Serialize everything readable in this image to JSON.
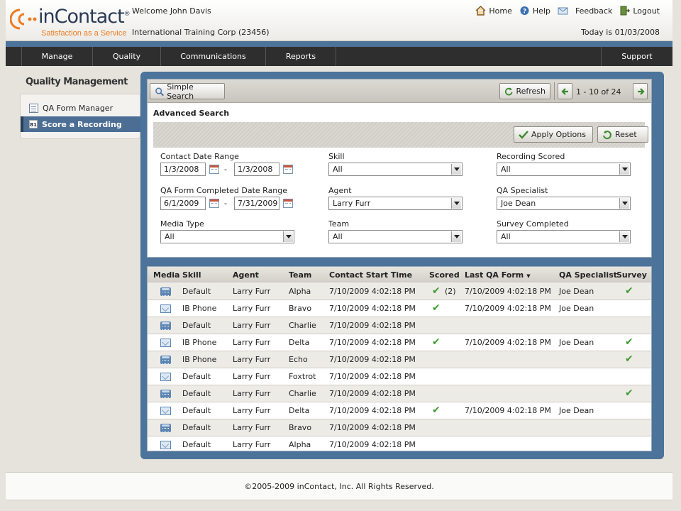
{
  "header": {
    "brand_prefix": "in",
    "brand_name": "Contact",
    "tagline": "Satisfaction as a Service",
    "welcome": "Welcome John Davis",
    "company": "International Training Corp (23456)",
    "today": "Today is 01/03/2008",
    "links": {
      "home": "Home",
      "help": "Help",
      "feedback": "Feedback",
      "logout": "Logout"
    }
  },
  "nav": {
    "manage": "Manage",
    "quality": "Quality",
    "communications": "Communications",
    "reports": "Reports",
    "support": "Support"
  },
  "sidebar": {
    "title": "Quality Management",
    "items": [
      {
        "label": "QA Form Manager",
        "icon": "form-icon"
      },
      {
        "label": "Score a Recording",
        "icon": "score-icon",
        "badge": "81",
        "selected": true
      }
    ]
  },
  "toolbar": {
    "simple_search": "Simple Search",
    "refresh": "Refresh",
    "pager": "1 - 10 of 24"
  },
  "advanced": {
    "title": "Advanced Search",
    "apply": "Apply Options",
    "reset": "Reset",
    "contact_date_label": "Contact Date Range",
    "contact_date_from": "1/3/2008",
    "contact_date_to": "1/3/2008",
    "qa_completed_label": "QA Form Completed Date Range",
    "qa_completed_from": "6/1/2009",
    "qa_completed_to": "7/31/2009",
    "media_type_label": "Media Type",
    "media_type_value": "All",
    "skill_label": "Skill",
    "skill_value": "All",
    "agent_label": "Agent",
    "agent_value": "Larry Furr",
    "team_label": "Team",
    "team_value": "All",
    "recording_scored_label": "Recording Scored",
    "recording_scored_value": "All",
    "qa_specialist_label": "QA Specialist",
    "qa_specialist_value": "Joe Dean",
    "survey_completed_label": "Survey Completed",
    "survey_completed_value": "All",
    "range_separator": "-"
  },
  "table": {
    "headers": {
      "media": "Media",
      "skill": "Skill",
      "agent": "Agent",
      "team": "Team",
      "start": "Contact Start Time",
      "scored": "Scored",
      "last_qa": "Last QA Form",
      "specialist": "QA Specialist",
      "survey": "Survey"
    },
    "rows": [
      {
        "media": "phone",
        "skill": "Default",
        "agent": "Larry Furr",
        "team": "Alpha",
        "start": "7/10/2009 4:02:18 PM",
        "scored": true,
        "score_count": "(2)",
        "last_qa": "7/10/2009 4:02:18 PM",
        "specialist": "Joe Dean",
        "survey": true
      },
      {
        "media": "mail",
        "skill": "IB Phone",
        "agent": "Larry Furr",
        "team": "Bravo",
        "start": "7/10/2009 4:02:18 PM",
        "scored": true,
        "score_count": "",
        "last_qa": "7/10/2009 4:02:18 PM",
        "specialist": "Joe Dean",
        "survey": false
      },
      {
        "media": "phone",
        "skill": "Default",
        "agent": "Larry Furr",
        "team": "Charlie",
        "start": "7/10/2009 4:02:18 PM",
        "scored": false,
        "score_count": "",
        "last_qa": "",
        "specialist": "",
        "survey": false
      },
      {
        "media": "mail",
        "skill": "IB Phone",
        "agent": "Larry Furr",
        "team": "Delta",
        "start": "7/10/2009 4:02:18 PM",
        "scored": true,
        "score_count": "",
        "last_qa": "7/10/2009 4:02:18 PM",
        "specialist": "Joe Dean",
        "survey": true
      },
      {
        "media": "phone",
        "skill": "IB Phone",
        "agent": "Larry Furr",
        "team": "Echo",
        "start": "7/10/2009 4:02:18 PM",
        "scored": false,
        "score_count": "",
        "last_qa": "",
        "specialist": "",
        "survey": true
      },
      {
        "media": "mail",
        "skill": "Default",
        "agent": "Larry Furr",
        "team": "Foxtrot",
        "start": "7/10/2009 4:02:18 PM",
        "scored": false,
        "score_count": "",
        "last_qa": "",
        "specialist": "",
        "survey": false
      },
      {
        "media": "phone",
        "skill": "Default",
        "agent": "Larry Furr",
        "team": "Charlie",
        "start": "7/10/2009 4:02:18 PM",
        "scored": false,
        "score_count": "",
        "last_qa": "",
        "specialist": "",
        "survey": true
      },
      {
        "media": "mail",
        "skill": "Default",
        "agent": "Larry Furr",
        "team": "Delta",
        "start": "7/10/2009 4:02:18 PM",
        "scored": true,
        "score_count": "",
        "last_qa": "7/10/2009 4:02:18 PM",
        "specialist": "Joe Dean",
        "survey": false
      },
      {
        "media": "phone",
        "skill": "Default",
        "agent": "Larry Furr",
        "team": "Bravo",
        "start": "7/10/2009 4:02:18 PM",
        "scored": false,
        "score_count": "",
        "last_qa": "",
        "specialist": "",
        "survey": false
      },
      {
        "media": "mail",
        "skill": "Default",
        "agent": "Larry Furr",
        "team": "Alpha",
        "start": "7/10/2009 4:02:18 PM",
        "scored": false,
        "score_count": "",
        "last_qa": "",
        "specialist": "",
        "survey": false
      }
    ]
  },
  "footer": {
    "copyright": "©2005-2009 inContact, Inc. All Rights Reserved."
  },
  "colors": {
    "accent_blue": "#4c7399",
    "brand_orange": "#ec7b21",
    "check_green": "#3f9a33",
    "nav_dark": "#2e2e2e"
  }
}
